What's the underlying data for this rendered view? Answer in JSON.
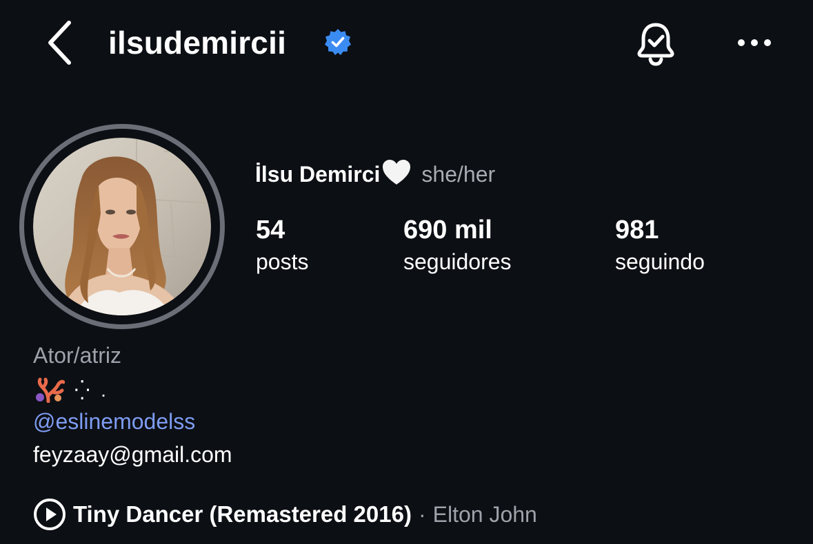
{
  "header": {
    "username": "ilsudemircii",
    "verified_color": "#3b8cf2"
  },
  "profile": {
    "full_name": "İlsu Demirci",
    "name_emoji": "white-heart",
    "pronouns": "she/her",
    "stats": [
      {
        "value": "54",
        "label": "posts"
      },
      {
        "value": "690 mil",
        "label": "seguidores"
      },
      {
        "value": "981",
        "label": "seguindo"
      }
    ]
  },
  "bio": {
    "category": "Ator/atriz",
    "emoji": "coral-emoji",
    "dots": "⁛ .",
    "mention": "@eslinemodelss",
    "email": "feyzaay@gmail.com"
  },
  "music": {
    "song": "Tiny Dancer (Remastered 2016)",
    "separator": "·",
    "artist": "Elton John"
  },
  "icons": {
    "back": "chevron-left-icon",
    "bell": "bell-check-icon",
    "more": "more-horizontal-icon",
    "play": "play-circle-icon"
  },
  "colors": {
    "background": "#0c0f14",
    "link": "#7e9cf2",
    "secondary_text": "#9ea2aa"
  }
}
